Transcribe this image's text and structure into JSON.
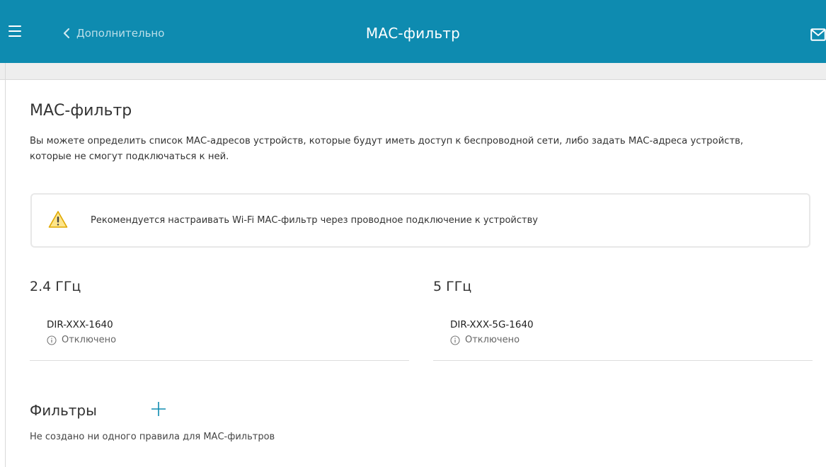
{
  "header": {
    "back_label": "Дополнительно",
    "title": "МАС-фильтр",
    "bg_color": "#0e8bb0"
  },
  "page": {
    "title": "МАС-фильтр",
    "description": "Вы можете определить список МАС-адресов устройств, которые будут иметь доступ к беспроводной сети, либо задать МАС-адреса устройств, которые не смогут подключаться к ней."
  },
  "warning": {
    "icon": "warning-triangle-icon",
    "text": "Рекомендуется настраивать Wi-Fi МАС-фильтр через проводное подключение к устройству"
  },
  "bands": [
    {
      "title": "2.4 ГГц",
      "ssid": "DIR-XXX-1640",
      "status": "Отключено"
    },
    {
      "title": "5 ГГц",
      "ssid": "DIR-XXX-5G-1640",
      "status": "Отключено"
    }
  ],
  "filters": {
    "title": "Фильтры",
    "empty_text": "Не создано ни одного правила для МАС-фильтров"
  }
}
